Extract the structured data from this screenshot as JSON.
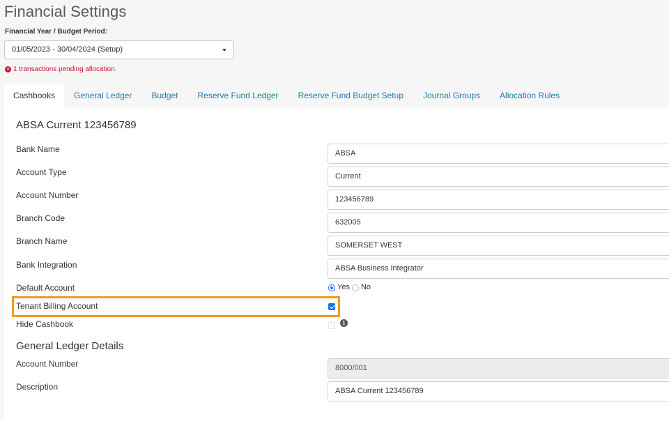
{
  "page": {
    "title": "Financial Settings"
  },
  "financial_year": {
    "label": "Financial Year / Budget Period:",
    "selected": "01/05/2023 - 30/04/2024 (Setup)"
  },
  "alert": {
    "icon": "error-circle-icon",
    "text": "1 transactions pending allocation."
  },
  "tabs": [
    {
      "label": "Cashbooks",
      "active": true
    },
    {
      "label": "General Ledger",
      "active": false
    },
    {
      "label": "Budget",
      "active": false
    },
    {
      "label": "Reserve Fund Ledger",
      "active": false
    },
    {
      "label": "Reserve Fund Budget Setup",
      "active": false
    },
    {
      "label": "Journal Groups",
      "active": false
    },
    {
      "label": "Allocation Rules",
      "active": false
    }
  ],
  "cashbook": {
    "title": "ABSA Current 123456789",
    "fields": {
      "bank_name": {
        "label": "Bank Name",
        "value": "ABSA"
      },
      "account_type": {
        "label": "Account Type",
        "value": "Current"
      },
      "account_number": {
        "label": "Account Number",
        "value": "123456789"
      },
      "branch_code": {
        "label": "Branch Code",
        "value": "632005"
      },
      "branch_name": {
        "label": "Branch Name",
        "value": "SOMERSET WEST"
      },
      "bank_integration": {
        "label": "Bank Integration",
        "value": "ABSA Business Integrator"
      }
    },
    "default_account": {
      "label": "Default Account",
      "yes": "Yes",
      "no": "No",
      "selected": "Yes"
    },
    "tenant_billing": {
      "label": "Tenant Billing Account",
      "checked": true
    },
    "hide_cashbook": {
      "label": "Hide Cashbook",
      "checked": false,
      "icon": "info-icon"
    }
  },
  "gl_details": {
    "title": "General Ledger Details",
    "account_number": {
      "label": "Account Number",
      "value": "8000/001"
    },
    "description": {
      "label": "Description",
      "value": "ABSA Current 123456789"
    }
  },
  "colors": {
    "accent": "#1a73e8",
    "link": "#1b7ea3",
    "error": "#c8102e",
    "highlight": "#f29a1f"
  }
}
